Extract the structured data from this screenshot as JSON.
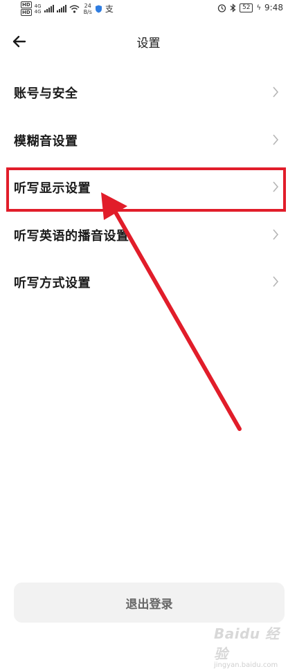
{
  "status_bar": {
    "hd_tag": "HD",
    "network_labels": [
      "4G",
      "4G"
    ],
    "speed_value": "24",
    "speed_unit": "B/s",
    "app_glyph": "支",
    "battery": "52",
    "time": "9:48"
  },
  "header": {
    "title": "设置",
    "back_icon": "arrow-left-icon"
  },
  "menu": {
    "items": [
      {
        "label": "账号与安全"
      },
      {
        "label": "模糊音设置"
      },
      {
        "label": "听写显示设置"
      },
      {
        "label": "听写英语的播音设置"
      },
      {
        "label": "听写方式设置"
      }
    ]
  },
  "annotation": {
    "highlighted_item": "听写显示设置",
    "color": "#e11d2a"
  },
  "logout": {
    "label": "退出登录"
  },
  "watermark": {
    "logo": "Baidu 经验",
    "sub": "jingyan.baidu.com"
  }
}
